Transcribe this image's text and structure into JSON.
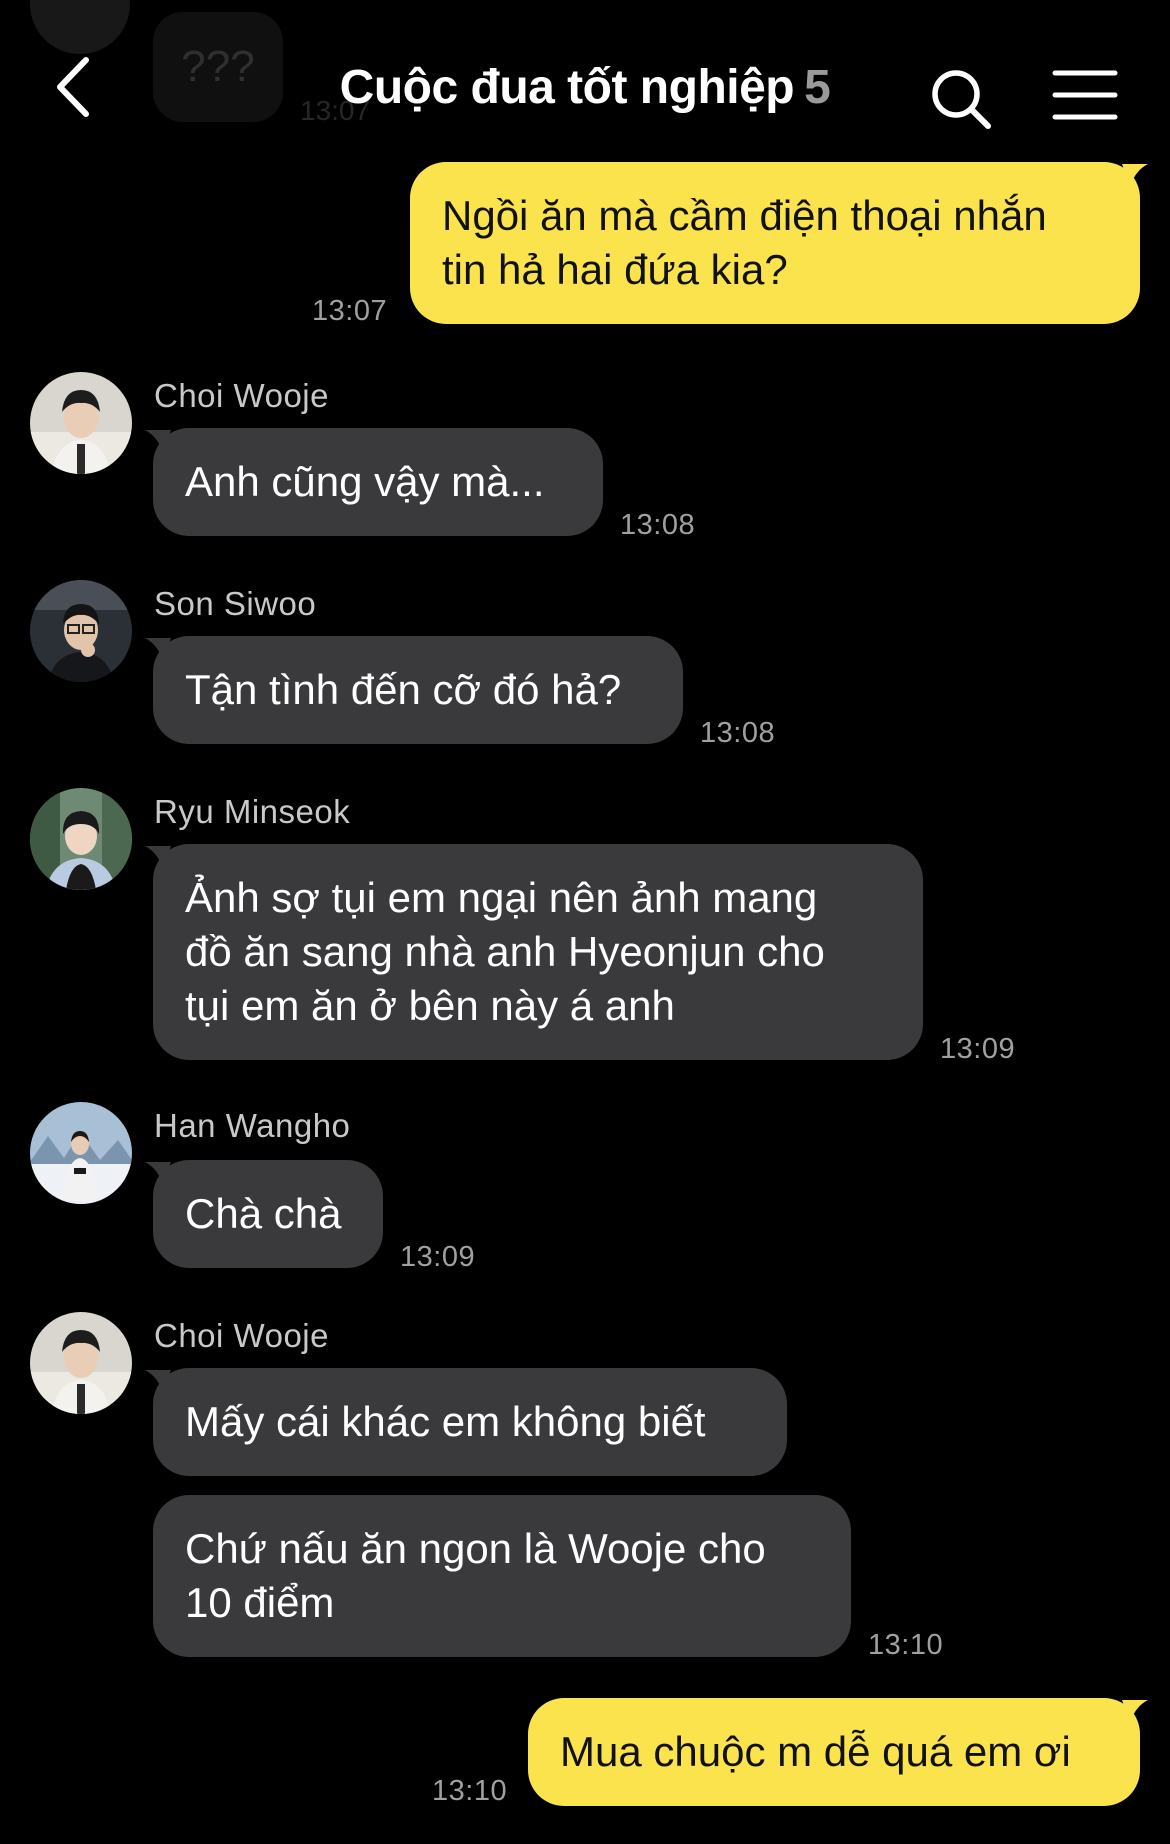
{
  "header": {
    "title": "Cuộc đua tốt nghiệp",
    "member_count": "5",
    "back_icon": "chevron-left-icon",
    "search_icon": "search-icon",
    "menu_icon": "hamburger-menu-icon"
  },
  "faded_previous": {
    "text": "???",
    "time": "13:07"
  },
  "colors": {
    "background": "#000000",
    "incoming_bubble": "#3a3a3c",
    "outgoing_bubble": "#fae34d",
    "timestamp": "#a0a0a0",
    "sender_name": "#c8c8c8"
  },
  "messages": [
    {
      "direction": "out",
      "text": "Ngồi ăn mà cầm điện thoại nhắn\ntin hả hai đứa kia?",
      "time": "13:07"
    },
    {
      "direction": "in",
      "sender": "Choi Wooje",
      "text": "Anh cũng vậy mà...",
      "time": "13:08"
    },
    {
      "direction": "in",
      "sender": "Son Siwoo",
      "text": "Tận tình đến cỡ đó hả?",
      "time": "13:08"
    },
    {
      "direction": "in",
      "sender": "Ryu Minseok",
      "text": "Ảnh sợ tụi em ngại nên ảnh mang\nđồ ăn sang nhà anh Hyeonjun cho\ntụi em ăn ở bên này á anh",
      "time": "13:09"
    },
    {
      "direction": "in",
      "sender": "Han Wangho",
      "text": "Chà chà",
      "time": "13:09"
    },
    {
      "direction": "in",
      "sender": "Choi Wooje",
      "text": "Mấy cái khác em không biết"
    },
    {
      "direction": "in",
      "text": "Chứ nấu ăn ngon là Wooje cho\n10 điểm",
      "time": "13:10"
    },
    {
      "direction": "out",
      "text": "Mua chuộc m dễ quá em ơi",
      "time": "13:10"
    }
  ]
}
